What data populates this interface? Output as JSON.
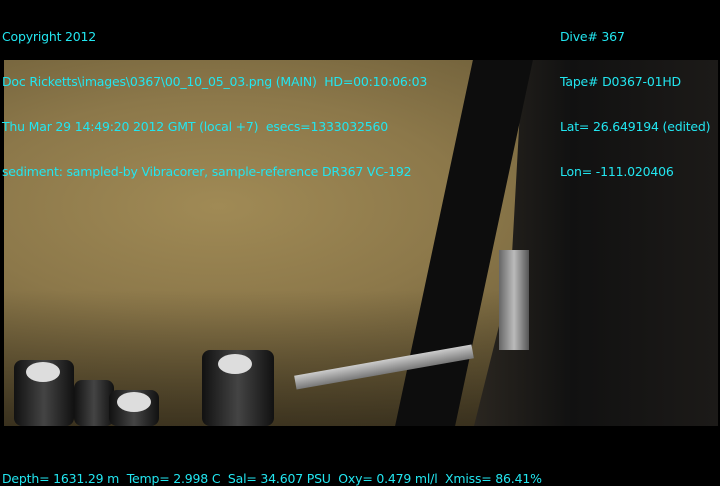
{
  "overlay": {
    "top_left": [
      "Copyright 2012",
      "Doc Ricketts\\images\\0367\\00_10_05_03.png (MAIN)  HD=00:10:06:03",
      "Thu Mar 29 14:49:20 2012 GMT (local +7)  esecs=1333032560",
      "sediment: sampled-by Vibracorer, sample-reference DR367 VC-192"
    ],
    "top_right": [
      "Dive# 367",
      "Tape# D0367-01HD",
      "Lat= 26.649194 (edited)",
      "Lon= -111.020406"
    ],
    "bottom": "Depth= 1631.29 m  Temp= 2.998 C  Sal= 34.607 PSU  Oxy= 0.479 ml/l  Xmiss= 86.41%"
  },
  "colors": {
    "overlay_text": "#22e6f0",
    "background": "#000000"
  }
}
